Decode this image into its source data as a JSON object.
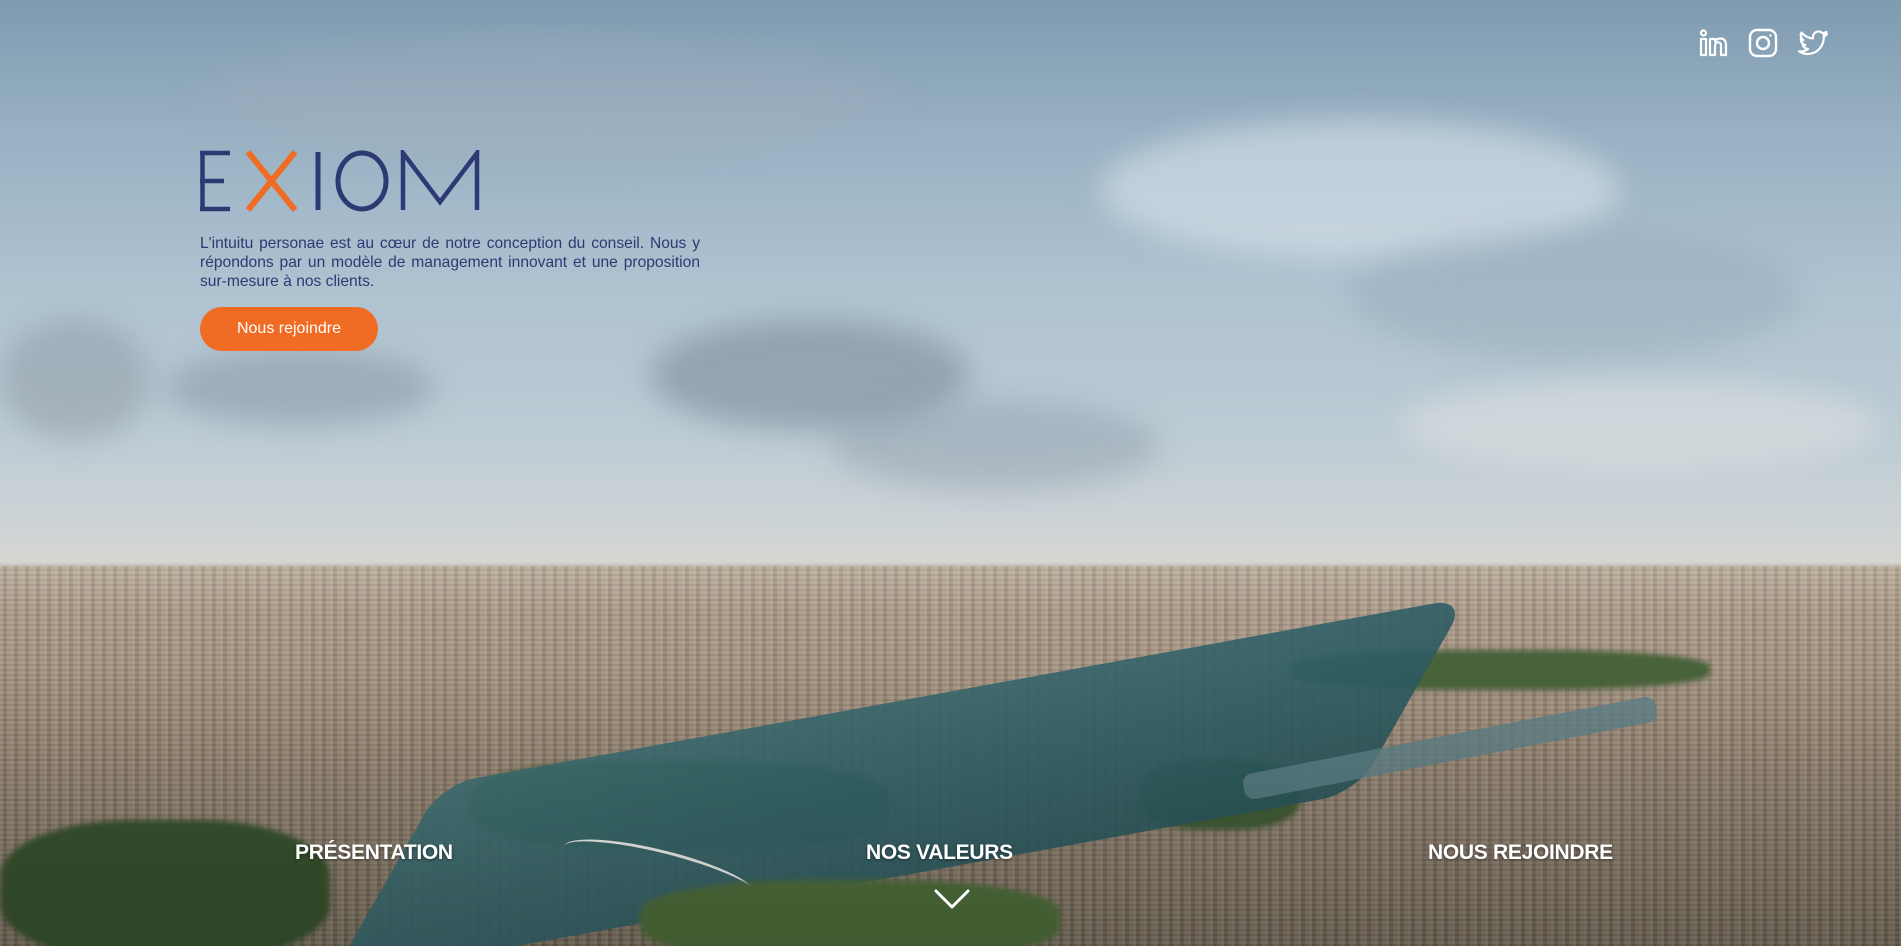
{
  "brand": {
    "name": "EXIOM",
    "colors": {
      "navy": "#2c3a73",
      "orange": "#f06b23"
    }
  },
  "social": [
    {
      "icon": "linkedin-icon",
      "label": "LinkedIn"
    },
    {
      "icon": "instagram-icon",
      "label": "Instagram"
    },
    {
      "icon": "twitter-icon",
      "label": "Twitter"
    }
  ],
  "hero": {
    "intro": "L'intuitu personae est au cœur de notre conception du conseil. Nous y répondons par un modèle de management innovant et une proposition sur-mesure à nos clients.",
    "cta_label": "Nous rejoindre"
  },
  "nav": [
    {
      "label": "PRÉSENTATION"
    },
    {
      "label": "NOS VALEURS"
    },
    {
      "label": "NOUS REJOINDRE"
    }
  ],
  "scroll_icon": "chevron-down-icon"
}
